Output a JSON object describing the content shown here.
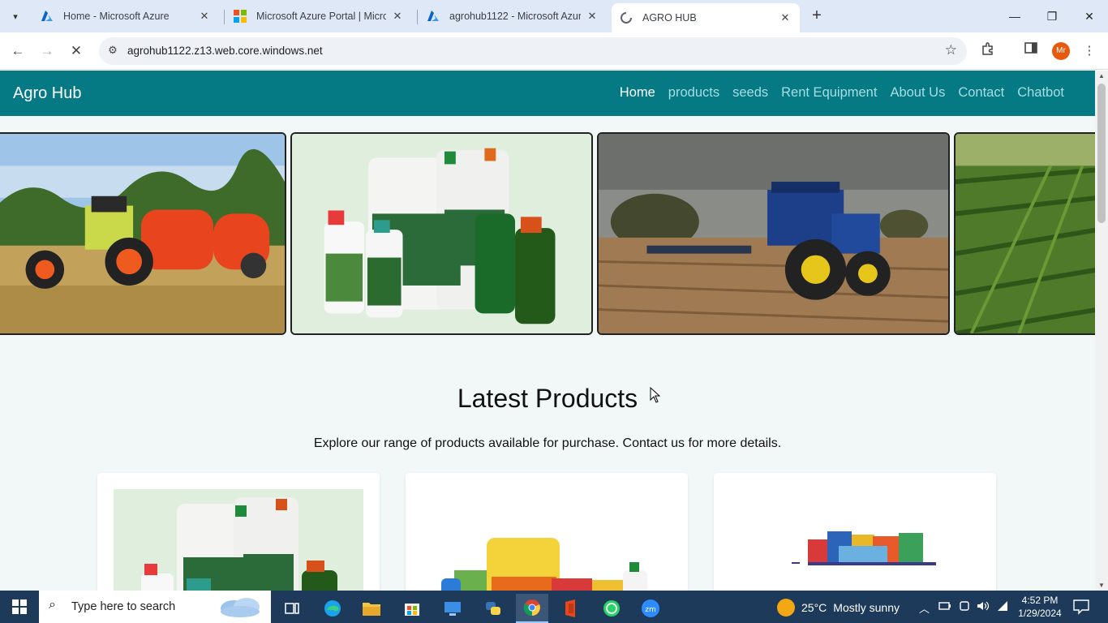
{
  "browser": {
    "tabs": [
      {
        "title": "Home - Microsoft Azure",
        "icon": "azure-icon"
      },
      {
        "title": "Microsoft Azure Portal | Micros",
        "icon": "microsoft-icon"
      },
      {
        "title": "agrohub1122 - Microsoft Azure",
        "icon": "azure-icon"
      },
      {
        "title": "AGRO HUB",
        "icon": "loading-icon"
      }
    ],
    "url": "agrohub1122.z13.web.core.windows.net",
    "profile_initials": "Mr"
  },
  "site": {
    "brand": "Agro Hub",
    "nav": [
      "Home",
      "products",
      "seeds",
      "Rent Equipment",
      "About Us",
      "Contact",
      "Chatbot"
    ],
    "active_nav": "Home",
    "accent_color": "#057a85",
    "section": {
      "title": "Latest Products",
      "subtitle": "Explore our range of products available for purchase. Contact us for more details."
    },
    "carousel": [
      {
        "image": "tractor-baler-image"
      },
      {
        "image": "fertilizer-bottles-image"
      },
      {
        "image": "blue-tractor-plowing-image"
      },
      {
        "image": "green-crop-field-image"
      }
    ],
    "products": [
      {
        "image": "fertilizer-bottles-image"
      },
      {
        "image": "fertilizer-bags-image"
      },
      {
        "image": "pesticide-packs-image"
      }
    ]
  },
  "taskbar": {
    "search_placeholder": "Type here to search",
    "weather": {
      "temp": "25°C",
      "condition": "Mostly sunny"
    },
    "time": "4:52 PM",
    "date": "1/29/2024"
  }
}
